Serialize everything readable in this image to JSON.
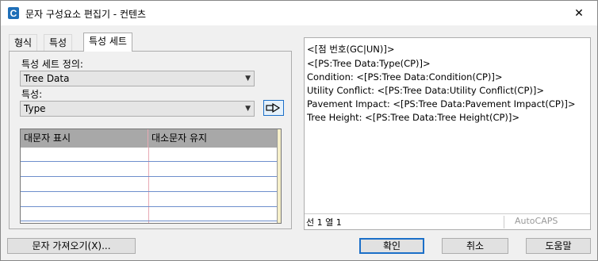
{
  "window": {
    "title": "문자 구성요소 편집기 - 컨텐츠",
    "app_icon_letter": "C",
    "close_symbol": "✕"
  },
  "tabs": [
    {
      "label": "형식",
      "active": false
    },
    {
      "label": "특성",
      "active": false
    },
    {
      "label": "특성 세트",
      "active": true
    }
  ],
  "left": {
    "property_set_label": "특성 세트 정의:",
    "property_set_value": "Tree Data",
    "property_label": "특성:",
    "property_value": "Type",
    "insert_icon": "insert-arrow-icon"
  },
  "grid": {
    "columns": [
      "대문자 표시",
      "대소문자 유지"
    ],
    "rows": [
      [
        "",
        ""
      ],
      [
        "",
        ""
      ],
      [
        "",
        ""
      ],
      [
        "",
        ""
      ],
      [
        "",
        ""
      ]
    ]
  },
  "editor": {
    "lines": [
      "<[점 번호(GC|UN)]>",
      "<[PS:Tree Data:Type(CP)]>",
      "Condition: <[PS:Tree Data:Condition(CP)]>",
      "Utility Conflict: <[PS:Tree Data:Utility Conflict(CP)]>",
      "Pavement Impact: <[PS:Tree Data:Pavement Impact(CP)]>",
      "Tree Height: <[PS:Tree Data:Tree Height(CP)]>"
    ],
    "status_position": "선 1 열 1",
    "status_brand": "AutoCAPS"
  },
  "buttons": {
    "import_text": "문자 가져오기(X)...",
    "ok": "확인",
    "cancel": "취소",
    "help": "도움말"
  },
  "colors": {
    "accent": "#1b6fc8",
    "grid_header": "#a8a8a8",
    "app_icon": "#1f6fb8"
  }
}
